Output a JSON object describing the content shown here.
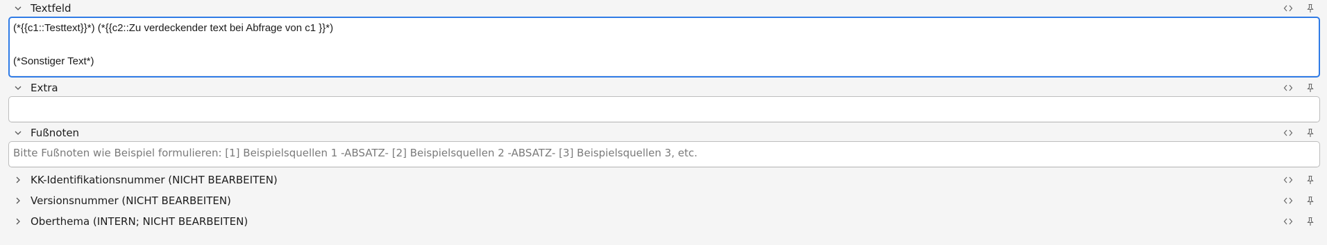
{
  "fields": {
    "textfeld": {
      "label": "Textfeld",
      "lines": [
        "(*{{c1::Testtext}}*) (*{{c2::Zu verdeckender text bei Abfrage von c1 }}*)",
        "",
        "(*Sonstiger Text*)"
      ]
    },
    "extra": {
      "label": "Extra",
      "value": ""
    },
    "fussnoten": {
      "label": "Fußnoten",
      "placeholder": "Bitte Fußnoten wie Beispiel formulieren: [1] Beispielsquellen 1 -ABSATZ- [2] Beispielsquellen 2 -ABSATZ- [3] Beispielsquellen 3, etc."
    },
    "kk_id": {
      "label": "KK-Identifikationsnummer (NICHT BEARBEITEN)"
    },
    "version": {
      "label": "Versionsnummer (NICHT BEARBEITEN)"
    },
    "oberthema": {
      "label": "Oberthema (INTERN; NICHT BEARBEITEN)"
    }
  },
  "icons": {
    "expanded": "chevron-down-icon",
    "collapsed": "chevron-right-icon",
    "html_toggle": "code-brackets-icon",
    "pin": "pin-icon"
  },
  "colors": {
    "focus_border": "#2f7be6",
    "background": "#f5f5f5",
    "input_background": "#ffffff",
    "placeholder": "#7a7a7a"
  }
}
